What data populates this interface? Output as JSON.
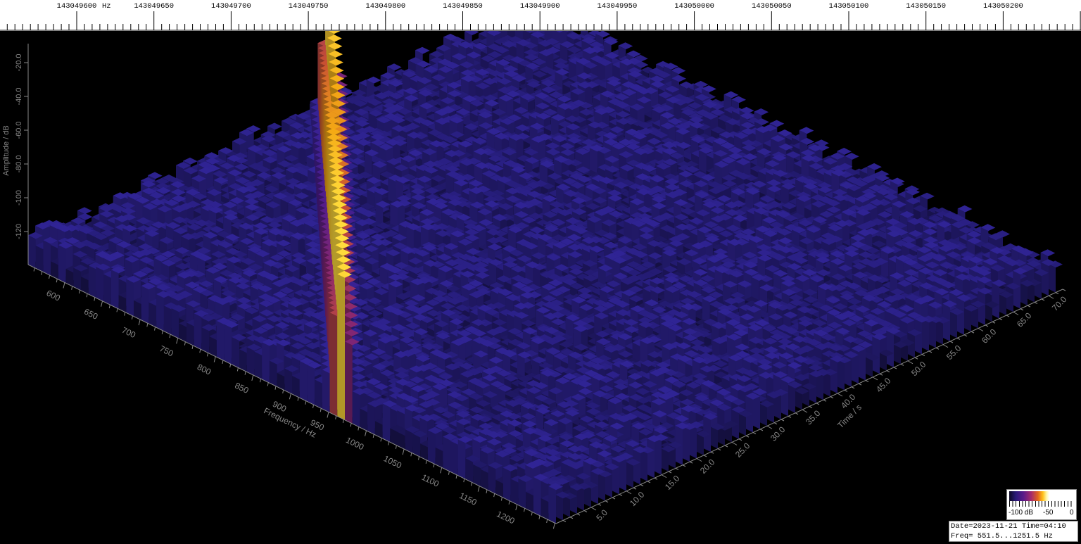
{
  "top_axis": {
    "unit": "Hz",
    "labels": [
      "143049600",
      "143049650",
      "143049700",
      "143049750",
      "143049800",
      "143049850",
      "143049900",
      "143049950",
      "143050000",
      "143050050",
      "143050100",
      "143050150",
      "143050200"
    ]
  },
  "legend": {
    "labels": [
      "-100 dB",
      "-50",
      "0"
    ],
    "colors": [
      "#0d0a22",
      "#2a1a78",
      "#5a1a8a",
      "#a62a6a",
      "#e0621e",
      "#ffc11a",
      "#ffffff"
    ]
  },
  "info": {
    "line1": "Date=2023-11-21 Time=04:10",
    "line2": "Freq= 551.5...1251.5 Hz"
  },
  "chart_data": {
    "type": "surface-3d",
    "xlabel": "Frequency / Hz",
    "ylabel": "Time / s",
    "zlabel": "Amplitude / dB",
    "x_ticks": [
      "600",
      "650",
      "700",
      "750",
      "800",
      "850",
      "900",
      "950",
      "1000",
      "1050",
      "1100",
      "1150",
      "1200"
    ],
    "y_ticks": [
      "5.0",
      "10.0",
      "15.0",
      "20.0",
      "25.0",
      "30.0",
      "35.0",
      "40.0",
      "45.0",
      "50.0",
      "55.0",
      "60.0",
      "65.0",
      "70.0"
    ],
    "z_ticks": [
      "-20.0",
      "-40.0",
      "-60.0",
      "-80.0",
      "-100",
      "-120"
    ],
    "xlim": [
      551.5,
      1251.5
    ],
    "ylim": [
      0,
      72
    ],
    "zlim": [
      -130,
      -10
    ],
    "noise_floor_db": -115,
    "signal_ridge": {
      "freq_start_hz": 970,
      "time_start_s": 0,
      "freq_end_hz": 580,
      "time_end_s": 40,
      "peak_amplitude_db": -45
    }
  }
}
